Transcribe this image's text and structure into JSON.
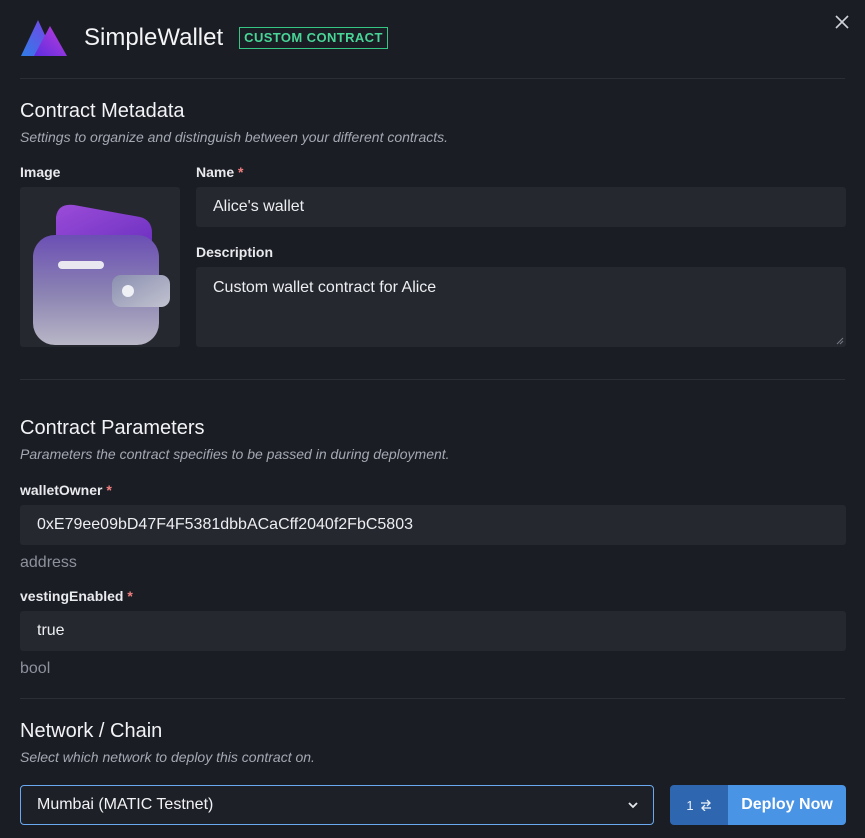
{
  "header": {
    "title": "SimpleWallet",
    "badge": "CUSTOM CONTRACT"
  },
  "metadata": {
    "title": "Contract Metadata",
    "subtitle": "Settings to organize and distinguish between your different contracts.",
    "image_label": "Image",
    "name_label": "Name",
    "name_value": "Alice's wallet",
    "description_label": "Description",
    "description_value": "Custom wallet contract for Alice"
  },
  "parameters": {
    "title": "Contract Parameters",
    "subtitle": "Parameters the contract specifies to be passed in during deployment.",
    "params": [
      {
        "name": "walletOwner",
        "value": "0xE79ee09bD47F4F5381dbbACaCff2040f2FbC5803",
        "type": "address"
      },
      {
        "name": "vestingEnabled",
        "value": "true",
        "type": "bool"
      }
    ]
  },
  "network": {
    "title": "Network / Chain",
    "subtitle": "Select which network to deploy this contract on.",
    "selected": "Mumbai (MATIC Testnet)"
  },
  "actions": {
    "count": "1",
    "count_icon": "swap-icon",
    "deploy_label": "Deploy Now"
  },
  "required_marker": "*"
}
